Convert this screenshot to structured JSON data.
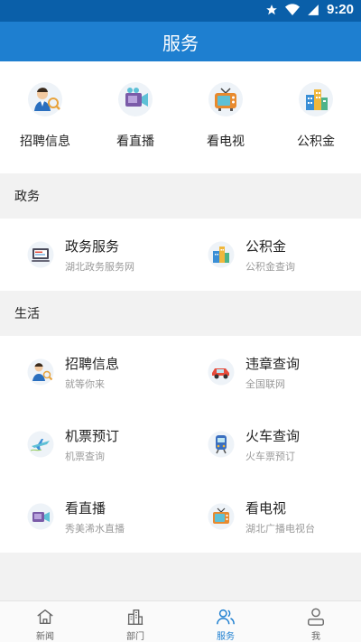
{
  "status_bar": {
    "time": "9:20",
    "icons": [
      "star-icon",
      "wifi-icon",
      "signal-icon"
    ]
  },
  "header": {
    "title": "服务"
  },
  "quick_items": [
    {
      "label": "招聘信息",
      "icon": "recruit-icon"
    },
    {
      "label": "看直播",
      "icon": "live-camera-icon"
    },
    {
      "label": "看电视",
      "icon": "tv-icon"
    },
    {
      "label": "公积金",
      "icon": "building-icon"
    }
  ],
  "sections": [
    {
      "title": "政务",
      "items": [
        {
          "title": "政务服务",
          "subtitle": "湖北政务服务网",
          "icon": "government-computer-icon"
        },
        {
          "title": "公积金",
          "subtitle": "公积金查询",
          "icon": "building-icon"
        }
      ]
    },
    {
      "title": "生活",
      "items": [
        {
          "title": "招聘信息",
          "subtitle": "就等你来",
          "icon": "recruit-icon"
        },
        {
          "title": "违章查询",
          "subtitle": "全国联网",
          "icon": "car-icon"
        },
        {
          "title": "机票预订",
          "subtitle": "机票查询",
          "icon": "plane-icon"
        },
        {
          "title": "火车查询",
          "subtitle": "火车票预订",
          "icon": "train-icon"
        },
        {
          "title": "看直播",
          "subtitle": "秀美浠水直播",
          "icon": "live-camera-icon"
        },
        {
          "title": "看电视",
          "subtitle": "湖北广播电视台",
          "icon": "tv-icon"
        }
      ]
    }
  ],
  "tabbar": {
    "active": "服务",
    "tabs": [
      {
        "label": "新闻",
        "icon": "home-icon"
      },
      {
        "label": "部门",
        "icon": "buildings-icon"
      },
      {
        "label": "服务",
        "icon": "people-icon"
      },
      {
        "label": "我",
        "icon": "user-icon"
      }
    ]
  },
  "colors": {
    "header": "#1e7fd0",
    "status_bar": "#0a5fa9",
    "active_tab": "#1e7fd0"
  }
}
